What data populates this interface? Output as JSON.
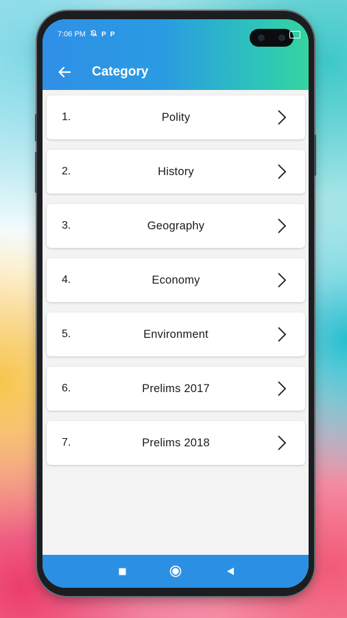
{
  "status_bar": {
    "time": "7:06 PM",
    "icons": [
      "alarm-off-icon",
      "p-icon",
      "p-icon",
      "battery-icon"
    ],
    "p1": "P",
    "p2": "P"
  },
  "appbar": {
    "title": "Category",
    "back_icon": "arrow-left-icon",
    "gradient_start": "#2f8fe6",
    "gradient_end": "#35d49e"
  },
  "categories": [
    {
      "index": "1.",
      "label": "Polity"
    },
    {
      "index": "2.",
      "label": "History"
    },
    {
      "index": "3.",
      "label": "Geography"
    },
    {
      "index": "4.",
      "label": "Economy"
    },
    {
      "index": "5.",
      "label": "Environment"
    },
    {
      "index": "6.",
      "label": "Prelims 2017"
    },
    {
      "index": "7.",
      "label": "Prelims 2018"
    }
  ],
  "navbar": {
    "buttons": [
      "recent-apps-icon",
      "home-icon",
      "back-triangle-icon"
    ],
    "color": "#2b8fe4"
  }
}
